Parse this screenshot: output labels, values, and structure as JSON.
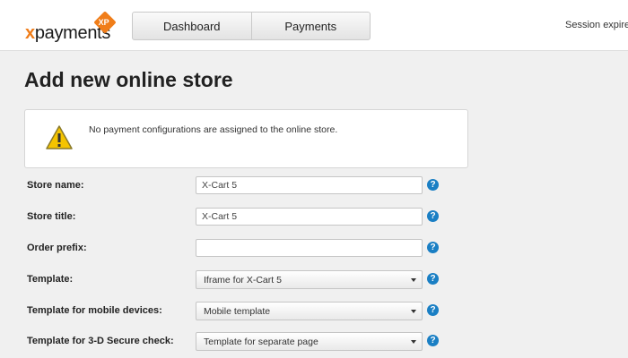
{
  "logo": {
    "text_x": "x",
    "text_rest": "payments",
    "badge": "XP"
  },
  "nav": {
    "items": [
      {
        "label": "Dashboard"
      },
      {
        "label": "Payments"
      }
    ]
  },
  "session": {
    "text": "Session expires"
  },
  "page": {
    "title": "Add new online store"
  },
  "warning": {
    "text": "No payment configurations are assigned to the online store."
  },
  "form": {
    "store_name": {
      "label": "Store name:",
      "value": "X-Cart 5"
    },
    "store_title": {
      "label": "Store title:",
      "value": "X-Cart 5"
    },
    "order_prefix": {
      "label": "Order prefix:",
      "value": ""
    },
    "template": {
      "label": "Template:",
      "value": "Iframe for X-Cart 5"
    },
    "template_mobile": {
      "label": "Template for mobile devices:",
      "value": "Mobile template"
    },
    "template_3ds": {
      "label": "Template for 3-D Secure check:",
      "value": "Template for separate page"
    },
    "help_symbol": "?"
  },
  "colors": {
    "accent": "#f07d19",
    "help": "#1a7fc4",
    "warning": "#f5c400"
  }
}
